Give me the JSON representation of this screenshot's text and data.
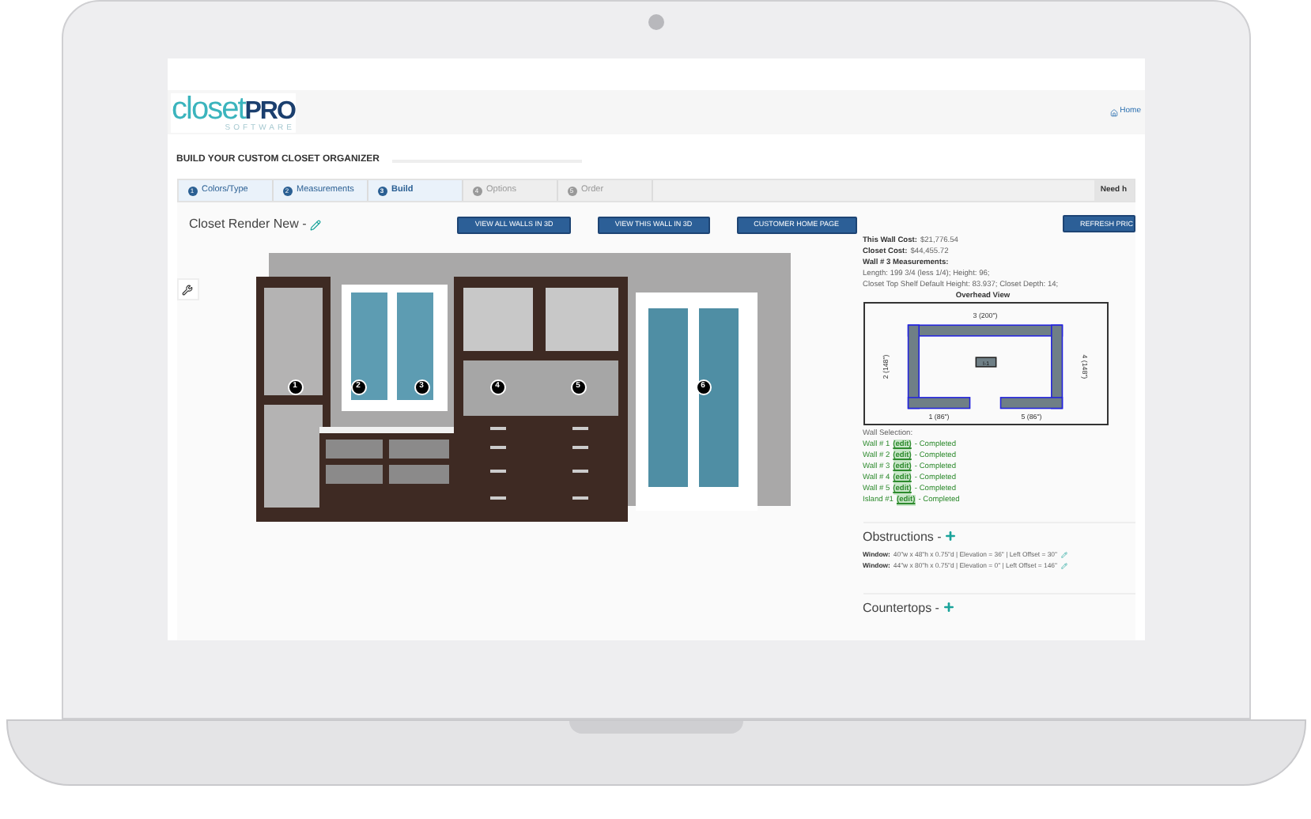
{
  "logo": {
    "word": "closet",
    "accent": "PRO",
    "tagline": "SOFTWARE"
  },
  "breadcrumb": "Home",
  "page_title": "BUILD YOUR CUSTOM CLOSET ORGANIZER",
  "steps": [
    {
      "number": "1",
      "label": "Colors/Type",
      "kind": "done"
    },
    {
      "number": "2",
      "label": "Measurements",
      "kind": "done"
    },
    {
      "number": "3",
      "label": "Build",
      "kind": "current"
    },
    {
      "number": "4",
      "label": "Options",
      "kind": "pending"
    },
    {
      "number": "5",
      "label": "Order",
      "kind": "pending"
    }
  ],
  "help_text": "Need h",
  "render_title": "Closet Render New -",
  "buttons": [
    "VIEW ALL WALLS IN 3D",
    "VIEW THIS WALL IN 3D",
    "CUSTOMER HOME PAGE",
    "REFRESH PRIC"
  ],
  "markers": [
    "1",
    "2",
    "3",
    "4",
    "5",
    "6"
  ],
  "costs": [
    {
      "label": "This Wall Cost:",
      "value": "$21,776.54"
    },
    {
      "label": "Closet Cost:",
      "value": "$44,455.72"
    }
  ],
  "measurements_title": "Wall # 3 Measurements:",
  "measurement_lines": [
    "Length: 199 3/4 (less 1/4); Height: 96;",
    "Closet Top Shelf Default Height: 83.937; Closet Depth: 14;"
  ],
  "overhead": {
    "title": "Overhead View",
    "top": "3 (200\")",
    "left": "2 (148\")",
    "right": "4 (148\")",
    "bottom_left": "1 (86\")",
    "bottom_right": "5 (86\")",
    "center": "I-1"
  },
  "wall_selection": {
    "title": "Wall Selection:",
    "items": [
      {
        "name": "Wall # 1",
        "link": "(edit)",
        "status": "- Completed"
      },
      {
        "name": "Wall # 2",
        "link": "(edit)",
        "status": "- Completed"
      },
      {
        "name": "Wall # 3",
        "link": "(edit)",
        "status": "- Completed"
      },
      {
        "name": "Wall # 4",
        "link": "(edit)",
        "status": "- Completed"
      },
      {
        "name": "Wall # 5",
        "link": "(edit)",
        "status": "- Completed"
      },
      {
        "name": "Island #1",
        "link": "(edit)",
        "status": "- Completed"
      }
    ]
  },
  "obstructions": {
    "title": "Obstructions -",
    "items": [
      {
        "label": "Window:",
        "text": "40\"w x 48\"h x 0.75\"d | Elevation = 36\" | Left Offset = 30\""
      },
      {
        "label": "Window:",
        "text": "44\"w x 80\"h x 0.75\"d | Elevation = 0\" | Left Offset = 146\""
      }
    ]
  },
  "countertops": {
    "title": "Countertops -"
  }
}
